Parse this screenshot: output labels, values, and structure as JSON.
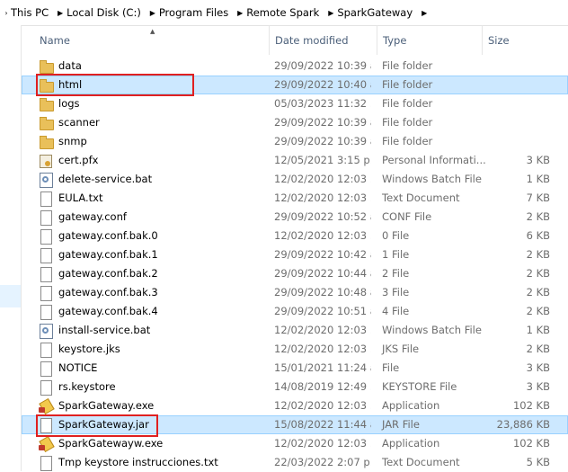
{
  "breadcrumb": [
    "This PC",
    "Local Disk (C:)",
    "Program Files",
    "Remote Spark",
    "SparkGateway"
  ],
  "columns": {
    "name": "Name",
    "date": "Date modified",
    "type": "Type",
    "size": "Size"
  },
  "files": [
    {
      "name": "data",
      "date": "29/09/2022 10:39 a...",
      "type": "File folder",
      "size": "",
      "icon": "folder-icon"
    },
    {
      "name": "html",
      "date": "29/09/2022 10:40 a...",
      "type": "File folder",
      "size": "",
      "icon": "folder-icon",
      "selected": true
    },
    {
      "name": "logs",
      "date": "05/03/2023 11:32 ...",
      "type": "File folder",
      "size": "",
      "icon": "folder-icon"
    },
    {
      "name": "scanner",
      "date": "29/09/2022 10:39 a...",
      "type": "File folder",
      "size": "",
      "icon": "folder-icon"
    },
    {
      "name": "snmp",
      "date": "29/09/2022 10:39 a...",
      "type": "File folder",
      "size": "",
      "icon": "folder-icon"
    },
    {
      "name": "cert.pfx",
      "date": "12/05/2021 3:15 p....",
      "type": "Personal Informati...",
      "size": "3 KB",
      "icon": "certificate-icon"
    },
    {
      "name": "delete-service.bat",
      "date": "12/02/2020 12:03 ...",
      "type": "Windows Batch File",
      "size": "1 KB",
      "icon": "batch-file-icon"
    },
    {
      "name": "EULA.txt",
      "date": "12/02/2020 12:03 ...",
      "type": "Text Document",
      "size": "7 KB",
      "icon": "document-icon"
    },
    {
      "name": "gateway.conf",
      "date": "29/09/2022 10:52 a...",
      "type": "CONF File",
      "size": "2 KB",
      "icon": "document-icon"
    },
    {
      "name": "gateway.conf.bak.0",
      "date": "12/02/2020 12:03 ...",
      "type": "0 File",
      "size": "6 KB",
      "icon": "document-icon"
    },
    {
      "name": "gateway.conf.bak.1",
      "date": "29/09/2022 10:42 a...",
      "type": "1 File",
      "size": "2 KB",
      "icon": "document-icon"
    },
    {
      "name": "gateway.conf.bak.2",
      "date": "29/09/2022 10:44 a...",
      "type": "2 File",
      "size": "2 KB",
      "icon": "document-icon"
    },
    {
      "name": "gateway.conf.bak.3",
      "date": "29/09/2022 10:48 a...",
      "type": "3 File",
      "size": "2 KB",
      "icon": "document-icon"
    },
    {
      "name": "gateway.conf.bak.4",
      "date": "29/09/2022 10:51 a...",
      "type": "4 File",
      "size": "2 KB",
      "icon": "document-icon"
    },
    {
      "name": "install-service.bat",
      "date": "12/02/2020 12:03 ...",
      "type": "Windows Batch File",
      "size": "1 KB",
      "icon": "batch-file-icon"
    },
    {
      "name": "keystore.jks",
      "date": "12/02/2020 12:03 ...",
      "type": "JKS File",
      "size": "2 KB",
      "icon": "document-icon"
    },
    {
      "name": "NOTICE",
      "date": "15/01/2021 11:24 a...",
      "type": "File",
      "size": "3 KB",
      "icon": "document-icon"
    },
    {
      "name": "rs.keystore",
      "date": "14/08/2019 12:49 ...",
      "type": "KEYSTORE File",
      "size": "3 KB",
      "icon": "document-icon"
    },
    {
      "name": "SparkGateway.exe",
      "date": "12/02/2020 12:03 ...",
      "type": "Application",
      "size": "102 KB",
      "icon": "application-icon"
    },
    {
      "name": "SparkGateway.jar",
      "date": "15/08/2022 11:44 a...",
      "type": "JAR File",
      "size": "23,886 KB",
      "icon": "document-icon",
      "selected": true
    },
    {
      "name": "SparkGatewayw.exe",
      "date": "12/02/2020 12:03 ...",
      "type": "Application",
      "size": "102 KB",
      "icon": "application-icon"
    },
    {
      "name": "Tmp keystore instrucciones.txt",
      "date": "22/03/2022 2:07 p....",
      "type": "Text Document",
      "size": "5 KB",
      "icon": "document-icon"
    }
  ]
}
